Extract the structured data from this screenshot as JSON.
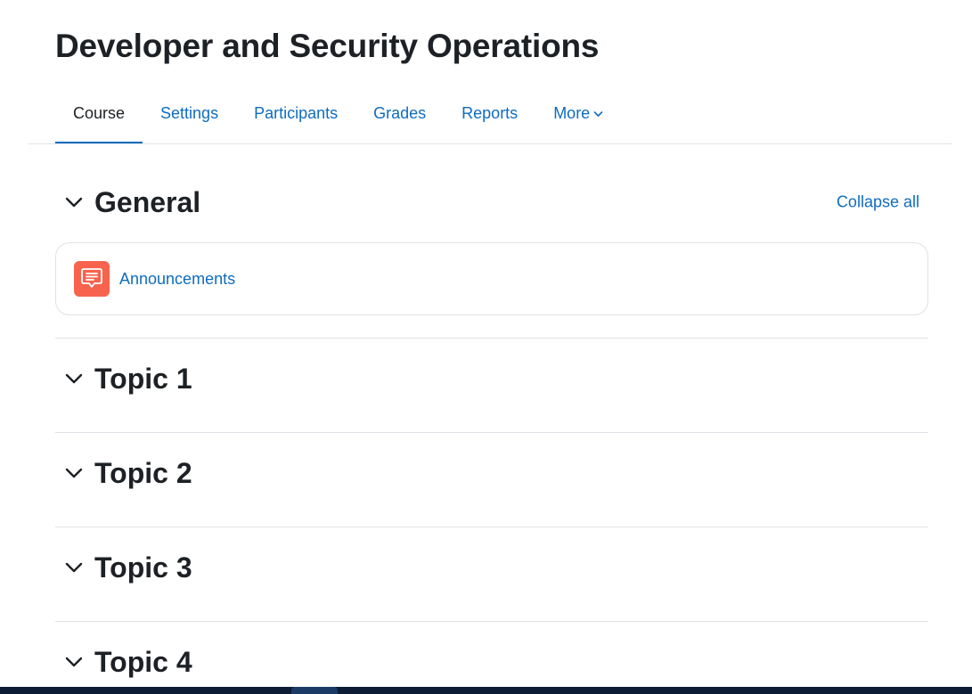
{
  "course": {
    "title": "Developer and Security Operations"
  },
  "nav": {
    "tabs": [
      {
        "label": "Course",
        "active": true
      },
      {
        "label": "Settings",
        "active": false
      },
      {
        "label": "Participants",
        "active": false
      },
      {
        "label": "Grades",
        "active": false
      },
      {
        "label": "Reports",
        "active": false
      },
      {
        "label": "More",
        "active": false,
        "dropdown": true,
        "icon": "chevron-down-icon"
      }
    ]
  },
  "content": {
    "collapse_all_label": "Collapse all",
    "sections": [
      {
        "title": "General",
        "expanded": true,
        "activities": [
          {
            "label": "Announcements",
            "type": "forum",
            "icon": "forum-icon",
            "icon_color": "#f7634d"
          }
        ]
      },
      {
        "title": "Topic 1",
        "expanded": true
      },
      {
        "title": "Topic 2",
        "expanded": true
      },
      {
        "title": "Topic 3",
        "expanded": true
      },
      {
        "title": "Topic 4",
        "expanded": true
      }
    ]
  },
  "colors": {
    "link": "#0f6cbf",
    "text": "#1d2125",
    "border": "#dee2e6",
    "forum_icon": "#f7634d",
    "taskbar": "#0b1c34"
  }
}
